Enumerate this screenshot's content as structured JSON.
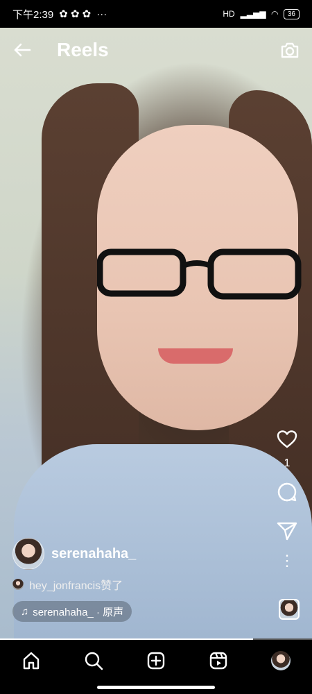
{
  "status_bar": {
    "time": "下午2:39",
    "notifications_label": "···",
    "network_label": "HD",
    "battery_level": "36"
  },
  "header": {
    "title": "Reels"
  },
  "reel": {
    "username": "serenahaha_",
    "liked_by_text": "hey_jonfrancis赞了",
    "audio_text": "serenahaha_ · 原声",
    "like_count": "1",
    "progress": 0.81
  },
  "icons": {
    "back": "back-arrow-icon",
    "camera": "camera-icon",
    "heart": "heart-icon",
    "comment": "comment-icon",
    "share": "paper-plane-icon",
    "more": "more-vertical-icon",
    "home": "home-icon",
    "search": "search-icon",
    "create": "add-square-icon",
    "reels": "reels-icon"
  }
}
